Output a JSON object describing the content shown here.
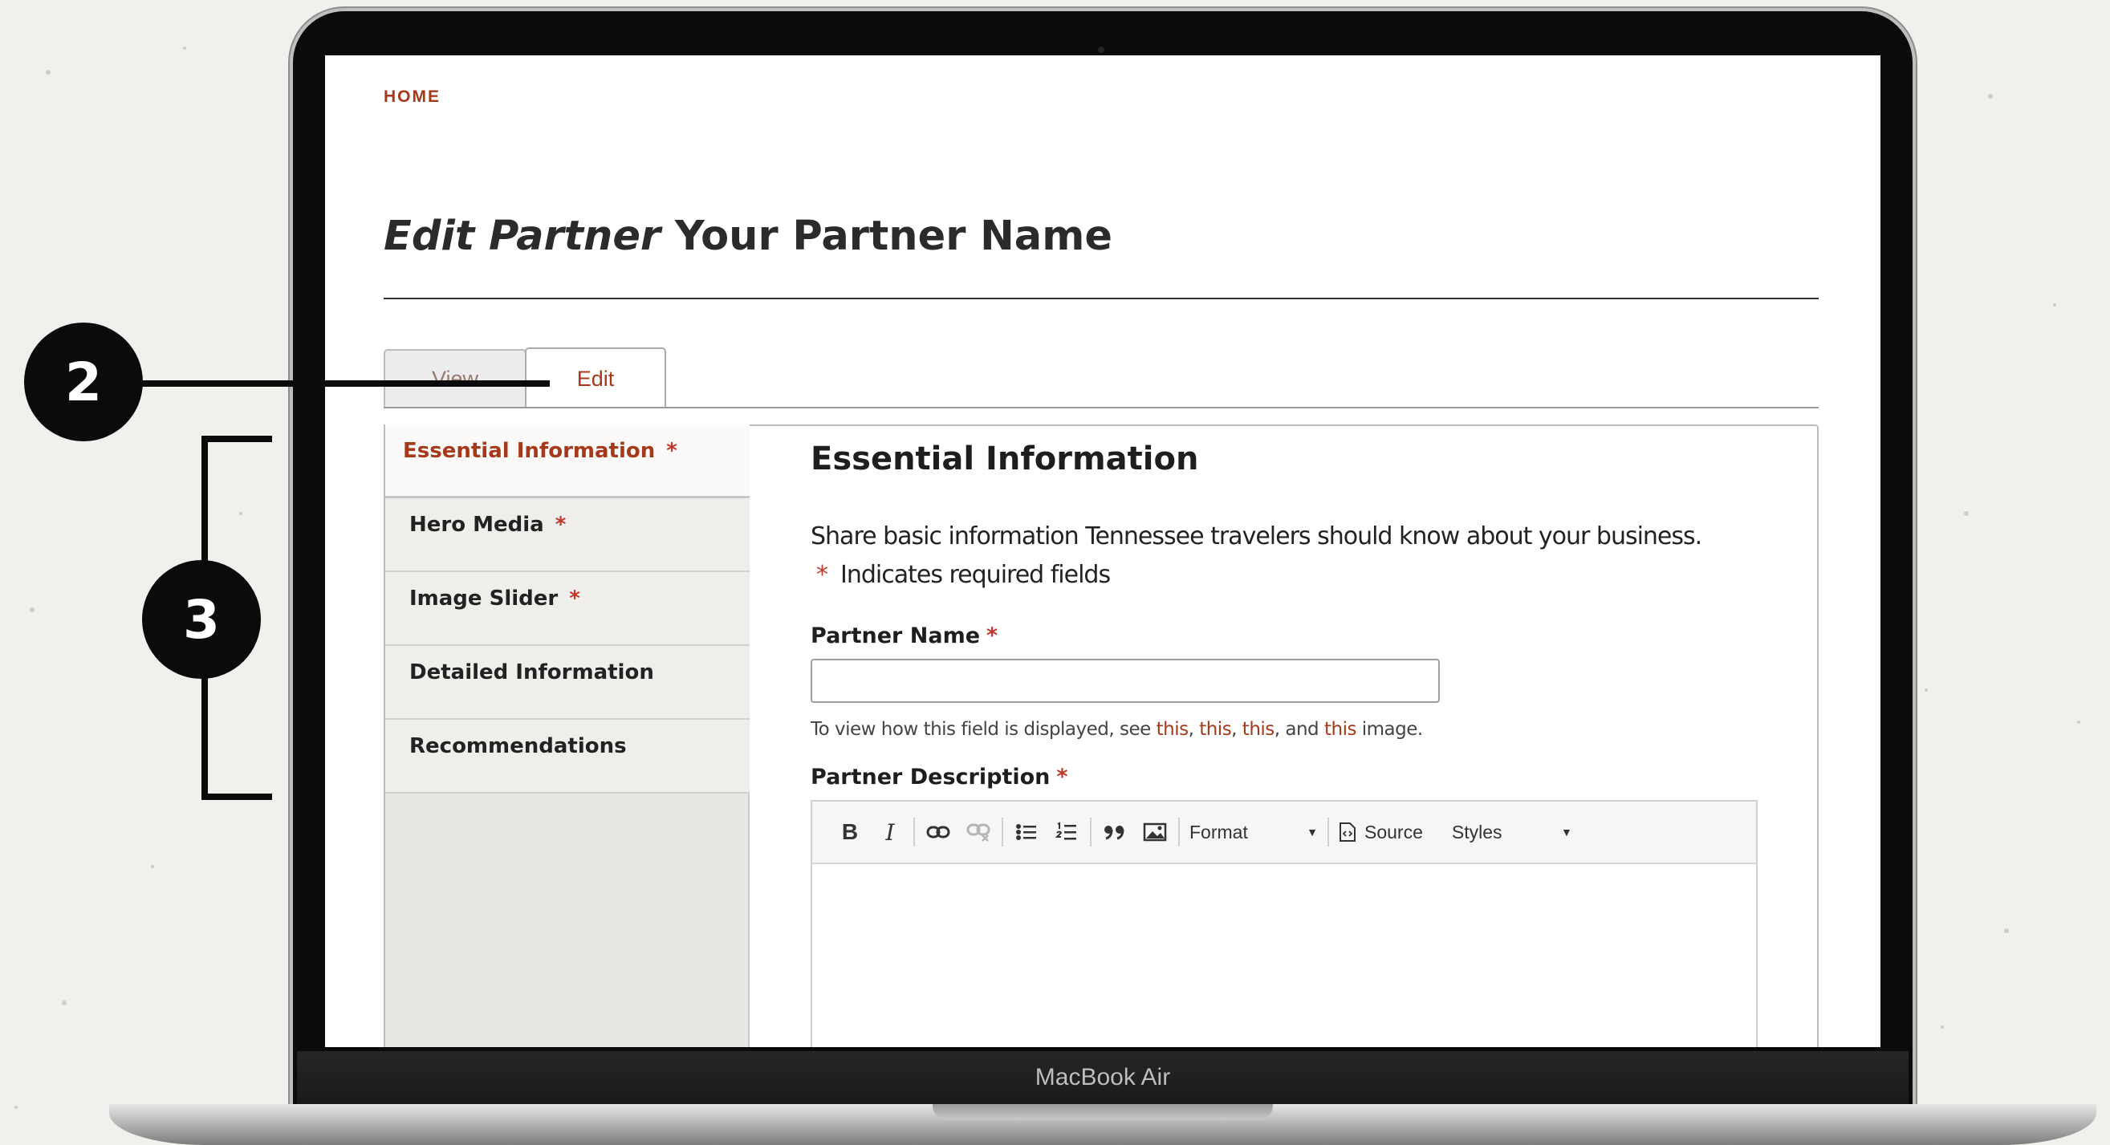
{
  "breadcrumb": {
    "home": "HOME"
  },
  "page": {
    "title_italic": "Edit Partner",
    "title_rest": "Your Partner Name"
  },
  "tabs": [
    {
      "label": "View"
    },
    {
      "label": "Edit"
    }
  ],
  "sidebar": {
    "items": [
      {
        "label": "Essential Information",
        "required": "*"
      },
      {
        "label": "Hero Media",
        "required": "*"
      },
      {
        "label": "Image Slider",
        "required": "*"
      },
      {
        "label": "Detailed Information"
      },
      {
        "label": "Recommendations"
      }
    ]
  },
  "section": {
    "title": "Essential Information",
    "intro": "Share basic information Tennessee travelers should know about your business.",
    "required_star": "*",
    "required_note": "Indicates required fields"
  },
  "fields": {
    "partner_name": {
      "label": "Partner Name",
      "required": "*",
      "value": ""
    },
    "help": {
      "prefix": "To view how this field is displayed, see",
      "link1": "this",
      "link2": "this",
      "link3": "this",
      "and": "and",
      "link4": "this",
      "suffix": "image."
    },
    "partner_description": {
      "label": "Partner Description",
      "required": "*"
    }
  },
  "editor_toolbar": {
    "bold": "B",
    "italic": "I",
    "format_label": "Format",
    "source_label": "Source",
    "styles_label": "Styles",
    "icons": [
      "bold-icon",
      "italic-icon",
      "link-icon",
      "unlink-icon",
      "bulleted-list-icon",
      "numbered-list-icon",
      "blockquote-icon",
      "image-icon",
      "source-icon"
    ]
  },
  "device": {
    "label": "MacBook Air"
  },
  "annotations": {
    "step_a": "2",
    "step_b": "3"
  },
  "colors": {
    "accent": "#a5391a",
    "required": "#c0392b",
    "text": "#222222"
  }
}
